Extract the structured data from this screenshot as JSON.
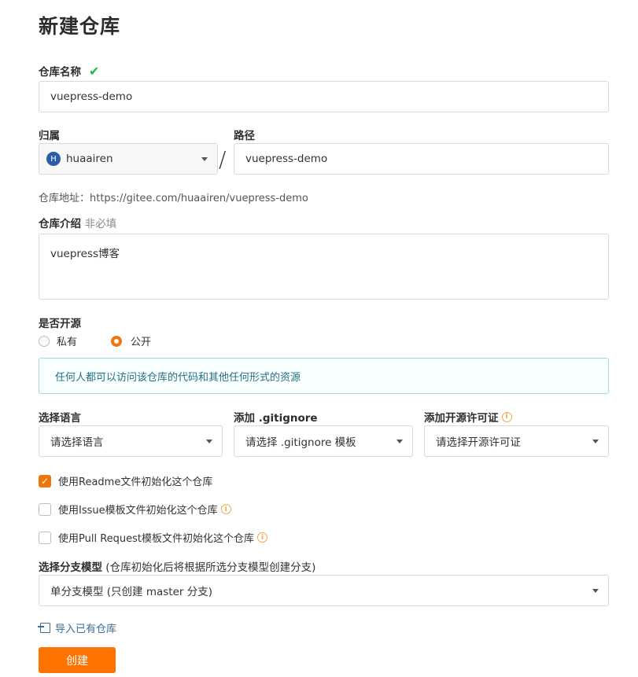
{
  "page": {
    "title": "新建仓库"
  },
  "repo_name": {
    "label": "仓库名称",
    "value": "vuepress-demo"
  },
  "owner": {
    "label": "归属",
    "avatar_letter": "H",
    "value": "huaairen"
  },
  "path": {
    "label": "路径",
    "separator": "/",
    "value": "vuepress-demo"
  },
  "repo_url": {
    "text": "仓库地址：https://gitee.com/huaairen/vuepress-demo"
  },
  "description": {
    "label": "仓库介绍",
    "optional": "非必填",
    "value": "vuepress博客"
  },
  "visibility": {
    "label": "是否开源",
    "options": [
      "私有",
      "公开"
    ],
    "selected": "公开",
    "info": "任何人都可以访问该仓库的代码和其他任何形式的资源"
  },
  "language": {
    "label": "选择语言",
    "placeholder": "请选择语言"
  },
  "gitignore": {
    "label": "添加 .gitignore",
    "placeholder": "请选择 .gitignore 模板"
  },
  "license": {
    "label": "添加开源许可证",
    "placeholder": "请选择开源许可证"
  },
  "init_options": [
    {
      "label": "使用Readme文件初始化这个仓库",
      "checked": true
    },
    {
      "label": "使用Issue模板文件初始化这个仓库",
      "checked": false
    },
    {
      "label": "使用Pull Request模板文件初始化这个仓库",
      "checked": false
    }
  ],
  "branch_model": {
    "label": "选择分支模型",
    "hint": "(仓库初始化后将根据所选分支模型创建分支)",
    "value": "单分支模型 (只创建 master 分支)"
  },
  "import_link": "导入已有仓库",
  "submit_button": "创建",
  "colors": {
    "accent": "#fe7300",
    "check_green": "#21ba45",
    "info_text": "#276f86",
    "link": "#3a6d9a"
  },
  "icons": [
    "check-icon",
    "avatar-icon",
    "chevron-down-icon",
    "info-icon",
    "import-icon"
  ]
}
